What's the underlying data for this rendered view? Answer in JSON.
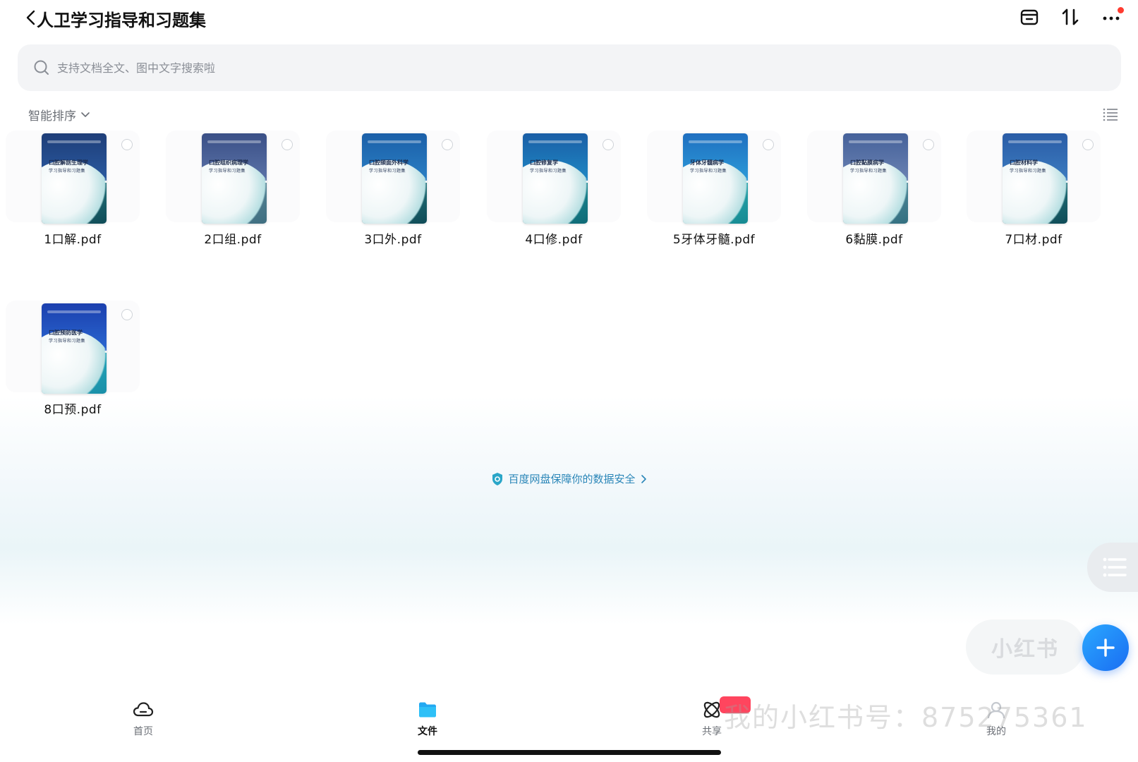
{
  "header": {
    "title": "人卫学习指导和习题集"
  },
  "search": {
    "placeholder": "支持文档全文、图中文字搜索啦"
  },
  "sort": {
    "label": "智能排序"
  },
  "files": [
    {
      "name": "1口解.pdf",
      "cover_title": "口腔解剖生理学",
      "cover_sub": "学习指导和习题集"
    },
    {
      "name": "2口组.pdf",
      "cover_title": "口腔组织病理学",
      "cover_sub": "学习指导和习题集"
    },
    {
      "name": "3口外.pdf",
      "cover_title": "口腔颌面外科学",
      "cover_sub": "学习指导和习题集"
    },
    {
      "name": "4口修.pdf",
      "cover_title": "口腔修复学",
      "cover_sub": "学习指导和习题集"
    },
    {
      "name": "5牙体牙髓.pdf",
      "cover_title": "牙体牙髓病学",
      "cover_sub": "学习指导和习题集"
    },
    {
      "name": "6黏膜.pdf",
      "cover_title": "口腔黏膜病学",
      "cover_sub": "学习指导和习题集"
    },
    {
      "name": "7口材.pdf",
      "cover_title": "口腔材料学",
      "cover_sub": "学习指导和习题集"
    },
    {
      "name": "8口预.pdf",
      "cover_title": "口腔预防医学",
      "cover_sub": "学习指导和习题集"
    }
  ],
  "security_banner": "百度网盘保障你的数据安全",
  "watermark": {
    "pill_text": "小红书",
    "line": "我的小红书号：875275361"
  },
  "tabs": [
    {
      "label": "首页",
      "icon": "cloud-icon"
    },
    {
      "label": "文件",
      "icon": "folder-icon"
    },
    {
      "label": "共享",
      "icon": "share-icon"
    },
    {
      "label": "我的",
      "icon": "profile-icon"
    }
  ],
  "colors": {
    "accent": "#1a6df2",
    "link": "#2a86b8",
    "notification": "#ff3b30"
  }
}
